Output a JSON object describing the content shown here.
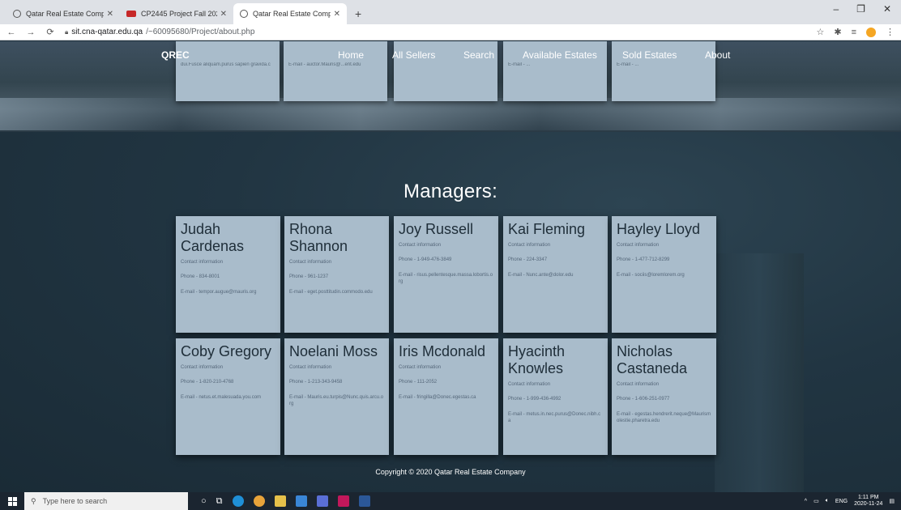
{
  "browser": {
    "tabs": [
      {
        "label": "Qatar Real Estate Company",
        "active": false
      },
      {
        "label": "CP2445 Project Fall 2020 - CP24",
        "active": false
      },
      {
        "label": "Qatar Real Estate Company",
        "active": true
      }
    ],
    "new_tab": "+",
    "window_controls": [
      "–",
      "❐",
      "✕"
    ],
    "url_host": "sit.cna-qatar.edu.qa",
    "url_path": "/~60095680/Project/about.php"
  },
  "nav": {
    "brand": "QREC",
    "items": [
      "Home",
      "All Sellers",
      "Search",
      "Available Estates",
      "Sold Estates",
      "About"
    ]
  },
  "top_cards": [
    {
      "line": "dui.Fusce aliquam.purus sapien gravida.c"
    },
    {
      "line": "E-mail - auctor.Mauris@...ent.edu"
    },
    {
      "line": ""
    },
    {
      "line": "E-mail - ..."
    },
    {
      "line": "E-mail - ..."
    }
  ],
  "managers": {
    "title": "Managers:",
    "contact_label": "Contact information",
    "cards": [
      {
        "name": "Judah Cardenas",
        "phone": "Phone - 834-8001",
        "email": "E-mail - tempor.augue@mauris.org"
      },
      {
        "name": "Rhona Shannon",
        "phone": "Phone - 961-1237",
        "email": "E-mail - eget.posttitudin.commodo.edu"
      },
      {
        "name": "Joy Russell",
        "phone": "Phone - 1-949-476-3849",
        "email": "E-mail - risus.pellentesque.massa.lobortis.org"
      },
      {
        "name": "Kai Fleming",
        "phone": "Phone - 224-3347",
        "email": "E-mail - Nunc.ante@dolor.edu"
      },
      {
        "name": "Hayley Lloyd",
        "phone": "Phone - 1-477-712-8299",
        "email": "E-mail - sociis@loremlorem.org"
      },
      {
        "name": "Coby Gregory",
        "phone": "Phone - 1-820-210-4768",
        "email": "E-mail - netus.et.malesuada.you.com"
      },
      {
        "name": "Noelani Moss",
        "phone": "Phone - 1-213-343-9458",
        "email": "E-mail - Mauris.eu.turpis@Nunc.quis.arcu.org"
      },
      {
        "name": "Iris Mcdonald",
        "phone": "Phone - 111-2052",
        "email": "E-mail - fringilla@Donec.egestas.ca"
      },
      {
        "name": "Hyacinth Knowles",
        "phone": "Phone - 1-999-436-4992",
        "email": "E-mail - metus.in.nec.purus@Donec.nibh.ca"
      },
      {
        "name": "Nicholas Castaneda",
        "phone": "Phone - 1-606-251-0977",
        "email": "E-mail - egestas.hendrerit.neque@Maurismolestie.pharetra.edu"
      }
    ]
  },
  "footer": "Copyright © 2020 Qatar Real Estate Company",
  "taskbar": {
    "search_placeholder": "Type here to search",
    "lang": "ENG",
    "time": "1:11 PM",
    "date": "2020-11-24"
  }
}
